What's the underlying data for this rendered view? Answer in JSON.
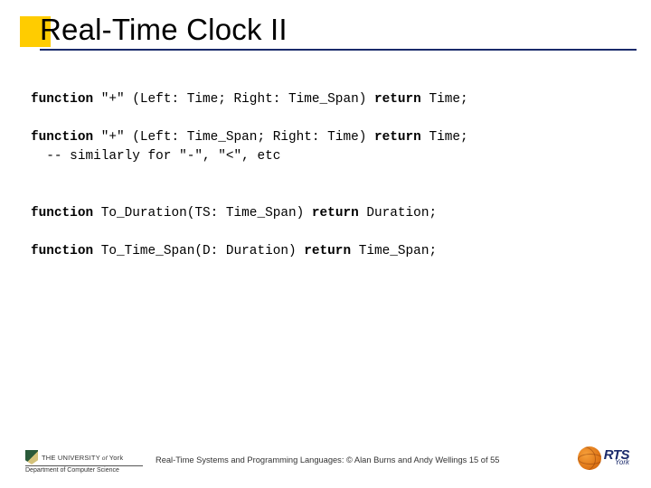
{
  "title": "Real-Time Clock II",
  "code": {
    "l1a": "function",
    "l1b": " \"+\" (Left: Time; Right: Time_Span) ",
    "l1c": "return",
    "l1d": " Time;",
    "l2a": "function",
    "l2b": " \"+\" (Left: Time_Span; Right: Time) ",
    "l2c": "return",
    "l2d": " Time;",
    "l3": "  -- similarly for \"-\", \"<\", etc",
    "l4a": "function",
    "l4b": " To_Duration(TS: Time_Span) ",
    "l4c": "return",
    "l4d": " Duration;",
    "l5a": "function",
    "l5b": " To_Time_Span(D: Duration) ",
    "l5c": "return",
    "l5d": " Time_Span;"
  },
  "footer": {
    "uni_the": "THE ",
    "uni_name": "UNIVERSITY",
    "uni_of": " of ",
    "uni_york": "York",
    "dept": "Department of Computer Science",
    "caption": "Real-Time Systems and Programming Languages: © Alan Burns and Andy Wellings 15 of 55",
    "rts": "RTS",
    "rts_york": "York"
  }
}
